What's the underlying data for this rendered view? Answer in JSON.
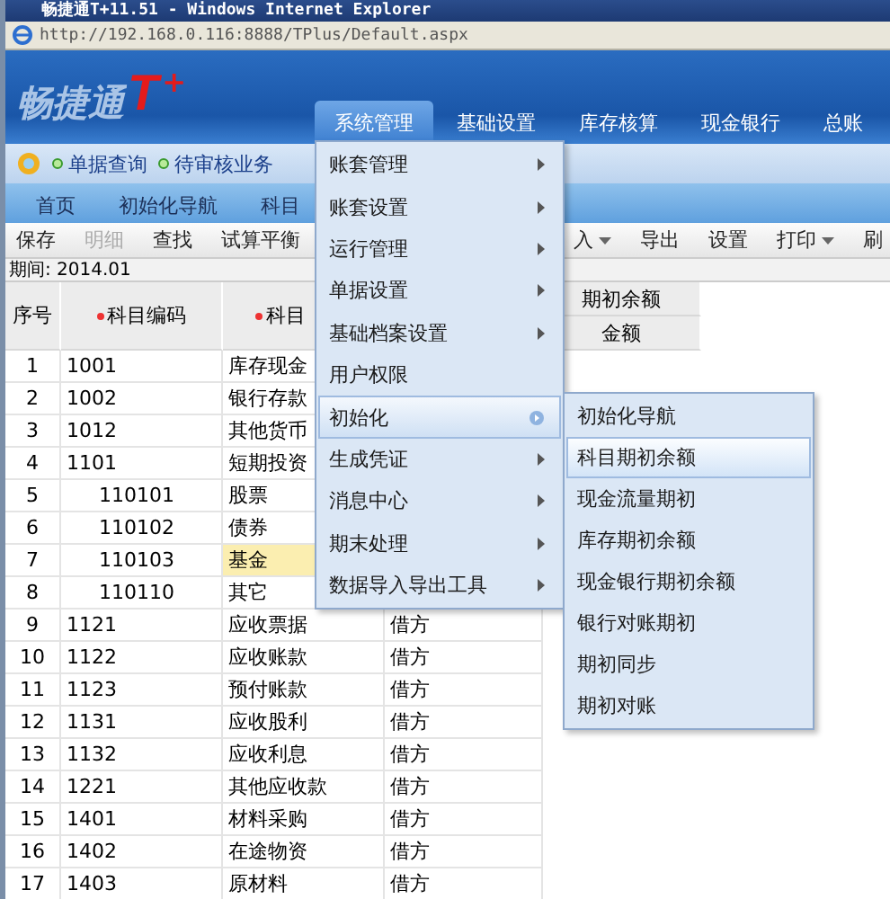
{
  "window": {
    "title": "畅捷通T+11.51 - Windows Internet Explorer"
  },
  "address": {
    "url": "http://192.168.0.116:8888/TPlus/Default.aspx"
  },
  "logo": {
    "name": "畅捷通",
    "mark": "T",
    "plus": "+"
  },
  "nav": [
    {
      "label": "系统管理",
      "selected": true
    },
    {
      "label": "基础设置",
      "selected": false
    },
    {
      "label": "库存核算",
      "selected": false
    },
    {
      "label": "现金银行",
      "selected": false
    },
    {
      "label": "总账",
      "selected": false
    }
  ],
  "quick_links": [
    "单据查询",
    "待审核业务"
  ],
  "tabs": [
    {
      "label": "首页",
      "selected": false
    },
    {
      "label": "初始化导航",
      "selected": false
    },
    {
      "label": "科目",
      "selected": false
    }
  ],
  "toolbar": [
    {
      "label": "保存",
      "disabled": false,
      "dropdown": false
    },
    {
      "label": "明细",
      "disabled": true,
      "dropdown": false
    },
    {
      "label": "查找",
      "disabled": false,
      "dropdown": false
    },
    {
      "label": "试算平衡",
      "disabled": false,
      "dropdown": false
    }
  ],
  "toolbar_right": [
    {
      "label": "入",
      "disabled": false,
      "dropdown": true
    },
    {
      "label": "导出",
      "disabled": false,
      "dropdown": false
    },
    {
      "label": "设置",
      "disabled": false,
      "dropdown": false
    },
    {
      "label": "打印",
      "disabled": false,
      "dropdown": true
    },
    {
      "label": "刷",
      "disabled": false,
      "dropdown": false
    }
  ],
  "period": "期间: 2014.01",
  "table": {
    "columns": [
      {
        "label": "序号",
        "required": false
      },
      {
        "label": "科目编码",
        "required": true
      },
      {
        "label": "科目",
        "required": true
      }
    ],
    "balance_header": "期初余额",
    "amount_header": "金额",
    "rows": [
      {
        "seq": "1",
        "code": "1001",
        "name": "库存现金",
        "selected": false
      },
      {
        "seq": "2",
        "code": "1002",
        "name": "银行存款",
        "selected": false
      },
      {
        "seq": "3",
        "code": "1012",
        "name": "其他货币",
        "selected": false
      },
      {
        "seq": "4",
        "code": "1101",
        "name": "短期投资",
        "selected": false,
        "children": [
          {
            "seq": "5",
            "code": "110101",
            "name": "股票",
            "selected": false
          },
          {
            "seq": "6",
            "code": "110102",
            "name": "债券",
            "selected": false
          },
          {
            "seq": "7",
            "code": "110103",
            "name": "基金",
            "selected": true
          },
          {
            "seq": "8",
            "code": "110110",
            "name": "其它",
            "selected": false
          }
        ]
      },
      {
        "seq": "9",
        "code": "1121",
        "name": "应收票据",
        "direction": "借方",
        "selected": false
      },
      {
        "seq": "10",
        "code": "1122",
        "name": "应收账款",
        "direction": "借方",
        "selected": false
      },
      {
        "seq": "11",
        "code": "1123",
        "name": "预付账款",
        "direction": "借方",
        "selected": false
      },
      {
        "seq": "12",
        "code": "1131",
        "name": "应收股利",
        "direction": "借方",
        "selected": false
      },
      {
        "seq": "13",
        "code": "1132",
        "name": "应收利息",
        "direction": "借方",
        "selected": false
      },
      {
        "seq": "14",
        "code": "1221",
        "name": "其他应收款",
        "direction": "借方",
        "selected": false
      },
      {
        "seq": "15",
        "code": "1401",
        "name": "材料采购",
        "direction": "借方",
        "selected": false
      },
      {
        "seq": "16",
        "code": "1402",
        "name": "在途物资",
        "direction": "借方",
        "selected": false
      },
      {
        "seq": "17",
        "code": "1403",
        "name": "原材料",
        "direction": "借方",
        "selected": false
      }
    ]
  },
  "menu": [
    {
      "label": "账套管理",
      "arrow": true,
      "selected": false
    },
    {
      "label": "账套设置",
      "arrow": true,
      "selected": false
    },
    {
      "label": "运行管理",
      "arrow": true,
      "selected": false
    },
    {
      "label": "单据设置",
      "arrow": true,
      "selected": false
    },
    {
      "label": "基础档案设置",
      "arrow": true,
      "selected": false
    },
    {
      "label": "用户权限",
      "arrow": false,
      "selected": false
    },
    {
      "label": "初始化",
      "arrow": true,
      "selected": true
    },
    {
      "label": "生成凭证",
      "arrow": true,
      "selected": false
    },
    {
      "label": "消息中心",
      "arrow": true,
      "selected": false
    },
    {
      "label": "期末处理",
      "arrow": true,
      "selected": false
    },
    {
      "label": "数据导入导出工具",
      "arrow": true,
      "selected": false
    }
  ],
  "submenu": [
    {
      "label": "初始化导航",
      "selected": false
    },
    {
      "label": "科目期初余额",
      "selected": true
    },
    {
      "label": "现金流量期初",
      "selected": false
    },
    {
      "label": "库存期初余额",
      "selected": false
    },
    {
      "label": "现金银行期初余额",
      "selected": false
    },
    {
      "label": "银行对账期初",
      "selected": false
    },
    {
      "label": "期初同步",
      "selected": false
    },
    {
      "label": "期初对账",
      "selected": false
    }
  ]
}
